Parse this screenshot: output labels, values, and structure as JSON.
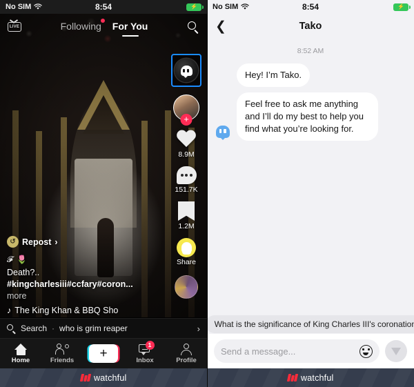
{
  "left": {
    "status": {
      "carrier": "No SIM",
      "time": "8:54",
      "battery_icon": "battery-charging-icon",
      "wifi_icon": "wifi-icon"
    },
    "topnav": {
      "live_label": "LIVE",
      "tabs": [
        {
          "label": "Following",
          "active": false,
          "has_dot": true
        },
        {
          "label": "For You",
          "active": true,
          "has_dot": false
        }
      ],
      "search_icon": "search-icon"
    },
    "rail": {
      "tako_button": "tako-icon",
      "avatar": "creator-avatar",
      "follow": "+",
      "like": {
        "icon": "heart-icon",
        "count": "8.9M"
      },
      "comment": {
        "icon": "comment-icon",
        "count": "151.7K"
      },
      "save": {
        "icon": "bookmark-icon",
        "count": "1.2M"
      },
      "share": {
        "icon": "snapchat-icon",
        "label": "Share"
      },
      "sound_disc": "sound-disc-icon"
    },
    "caption": {
      "repost_label": "Repost",
      "emoji_row": "𝓕 🌷",
      "line1": "Death?..",
      "tags": "#kingcharlesiii#ccfary#coron...",
      "more": " more",
      "music_icon": "music-note-icon",
      "music": "The King Khan & BBQ Sho"
    },
    "search_strip": {
      "icon": "search-icon",
      "label": "Search",
      "separator": "·",
      "query": "who is grim reaper",
      "chevron": "›"
    },
    "tabbar": [
      {
        "label": "Home",
        "icon": "home-icon",
        "active": true,
        "badge": ""
      },
      {
        "label": "Friends",
        "icon": "friends-icon",
        "active": false,
        "badge": ""
      },
      {
        "label": "",
        "icon": "create-plus-icon",
        "active": false,
        "badge": ""
      },
      {
        "label": "Inbox",
        "icon": "inbox-icon",
        "active": false,
        "badge": "1"
      },
      {
        "label": "Profile",
        "icon": "profile-icon",
        "active": false,
        "badge": ""
      }
    ],
    "create_label": "+"
  },
  "right": {
    "status": {
      "carrier": "No SIM",
      "time": "8:54",
      "battery_icon": "battery-charging-icon",
      "wifi_icon": "wifi-icon"
    },
    "header": {
      "back_icon": "back-chevron-icon",
      "title": "Tako"
    },
    "chat": {
      "timestamp": "8:52 AM",
      "messages": [
        {
          "sender": "tako",
          "text": "Hey! I’m Tako.",
          "show_avatar": false
        },
        {
          "sender": "tako",
          "text": "Feel free to ask me anything and I’ll do my best to help you find what you’re looking for.",
          "show_avatar": true
        }
      ],
      "suggestion": "What is the significance of King Charles III's coronation"
    },
    "composer": {
      "placeholder": "Send a message...",
      "value": "",
      "emoji_icon": "emoji-smiley-icon",
      "send_icon": "send-paperplane-icon"
    }
  },
  "footer": {
    "brand": "watchful",
    "logo_icon": "watchful-logo-icon"
  },
  "colors": {
    "accent_pink": "#fe2c55",
    "accent_cyan": "#20d5ea",
    "selection_blue": "#1a8cff",
    "snapchat_yellow": "#f7e94e",
    "watchful_red": "#fb2b3a",
    "chat_bg": "#f2f2f5"
  }
}
